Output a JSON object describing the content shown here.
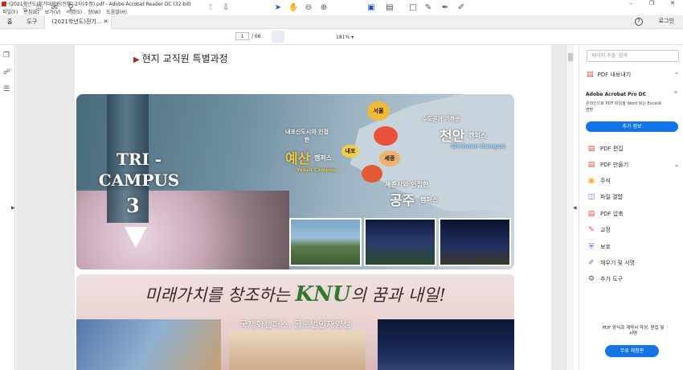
{
  "window": {
    "title": "(2021학년도)전기대학원(전체)-2차(수정).pdf - Adobe Acrobat Reader DC (32-bit)"
  },
  "menu": [
    "파일(F)",
    "편집(E)",
    "보기(V)",
    "서명(S)",
    "창(W)",
    "도움말(H)"
  ],
  "tabs": {
    "home": "홈",
    "tools": "도구",
    "doc": "(2021학년도)전기..."
  },
  "header": {
    "login": "로그인"
  },
  "toolbar": {
    "page_current": "1",
    "page_total": "/ 66",
    "zoom": "181%"
  },
  "page": {
    "heading_partial": "현지 교직원 특별과정",
    "banner1": {
      "tri_title": "TRI - CAMPUS",
      "tri_number": "3",
      "yesan_desc": "내포신도시와 인접한",
      "yesan_name": "예산",
      "yesan_suffix": "캠퍼스",
      "yesan_en": "Yesan Campus",
      "cheonan_desc": "수도권과 가까운",
      "cheonan_name": "천안",
      "cheonan_suffix": "캠퍼스",
      "cheonan_en": "Cheonan Campus",
      "gongju_desc": "세종시와 인접한",
      "gongju_name": "공주",
      "gongju_suffix": "캠퍼스",
      "seoul": "서울",
      "naepo": "내포",
      "sejong": "세종"
    },
    "banner2": {
      "slogan_pre": "미래가치를 창조하는 ",
      "slogan_knu": "KNU",
      "slogan_post": "의 꿈과 내일!",
      "subtitle": "국제화캠퍼스, 글로벌인재양성"
    }
  },
  "right_panel": {
    "search_placeholder": "'페이지 추출' 검색",
    "export_label": "PDF 내보내기",
    "pro_title": "Adobe Acrobat Pro DC",
    "pro_desc": "온라인으로 PDF 파일을 Word 또는 Excel로 변환",
    "pro_button": "추가 정보",
    "tools": [
      {
        "label": "PDF 편집",
        "icon": "edit-pdf-icon",
        "color": "#e0493f"
      },
      {
        "label": "PDF 만들기",
        "icon": "create-pdf-icon",
        "color": "#e0493f"
      },
      {
        "label": "주석",
        "icon": "comment-icon",
        "color": "#f2b01e"
      },
      {
        "label": "파일 결합",
        "icon": "combine-files-icon",
        "color": "#8c4bd8"
      },
      {
        "label": "PDF 압축",
        "icon": "compress-pdf-icon",
        "color": "#e0493f"
      },
      {
        "label": "교정",
        "icon": "redact-icon",
        "color": "#e0493f"
      },
      {
        "label": "보호",
        "icon": "protect-icon",
        "color": "#5a4bd8"
      },
      {
        "label": "채우기 및 서명",
        "icon": "fill-sign-icon",
        "color": "#8c4bd8"
      },
      {
        "label": "추가 도구",
        "icon": "more-tools-icon",
        "color": "#555555"
      }
    ],
    "promo_text": "PDF 양식과 계약서 작성, 편집 및 서명",
    "promo_button": "무료 체험판"
  },
  "colors": {
    "accent": "#1473e6",
    "brand": "#d4231c"
  }
}
